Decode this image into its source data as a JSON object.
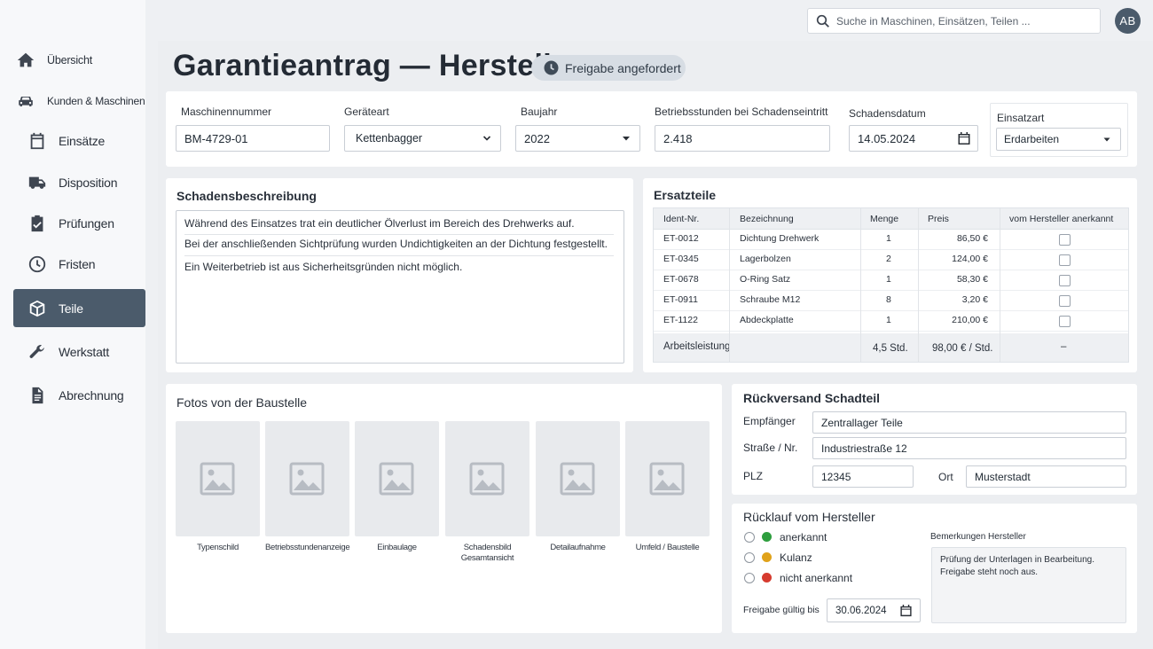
{
  "sidebar": {
    "items": [
      {
        "label": "Übersicht",
        "icon": "home-icon"
      },
      {
        "label": "Kunden & Maschinen",
        "icon": "car-icon"
      },
      {
        "label": "Einsätze",
        "icon": "calendar-icon"
      },
      {
        "label": "Disposition",
        "icon": "truck-icon"
      },
      {
        "label": "Prüfungen",
        "icon": "clipboard-check-icon"
      },
      {
        "label": "Fristen",
        "icon": "clock-icon"
      },
      {
        "label": "Teile",
        "icon": "box-icon",
        "active": true
      },
      {
        "label": "Werkstatt",
        "icon": "wrench-icon"
      },
      {
        "label": "Abrechnung",
        "icon": "document-icon"
      }
    ]
  },
  "topbar": {
    "search_placeholder": "Suche in Maschinen, Einsätzen, Teilen ...",
    "avatar_initials": "AB"
  },
  "header": {
    "title": "Garantieantrag — Hersteller",
    "status": "Freigabe angefordert"
  },
  "machine": {
    "number_label": "Maschinennummer",
    "number_value": "BM-4729-01",
    "type_label": "Geräteart",
    "type_value": "Kettenbagger",
    "year_label": "Baujahr",
    "year_value": "2022",
    "hours_label": "Betriebsstunden bei Schadenseintritt",
    "hours_value": "2.418",
    "date_label": "Schadensdatum",
    "date_value": "14.05.2024",
    "use_label": "Einsatzart",
    "use_value": "Erdarbeiten"
  },
  "description": {
    "title": "Schadensbeschreibung",
    "lines": [
      "Während des Einsatzes trat ein deutlicher Ölverlust im Bereich des Drehwerks auf.",
      "Bei der anschließenden Sichtprüfung wurden Undichtigkeiten an der Dichtung festgestellt.",
      "Ein Weiterbetrieb ist aus Sicherheitsgründen nicht möglich."
    ]
  },
  "parts": {
    "title": "Ersatzteile",
    "headers": [
      "Ident-Nr.",
      "Bezeichnung",
      "Menge",
      "Preis",
      "vom Hersteller anerkannt"
    ],
    "rows": [
      {
        "id": "ET-0012",
        "name": "Dichtung Drehwerk",
        "qty": "1",
        "price": "86,50 €"
      },
      {
        "id": "ET-0345",
        "name": "Lagerbolzen",
        "qty": "2",
        "price": "124,00 €"
      },
      {
        "id": "ET-0678",
        "name": "O-Ring Satz",
        "qty": "1",
        "price": "58,30 €"
      },
      {
        "id": "ET-0911",
        "name": "Schraube M12",
        "qty": "8",
        "price": "3,20 €"
      },
      {
        "id": "ET-1122",
        "name": "Abdeckplatte",
        "qty": "1",
        "price": "210,00 €"
      }
    ],
    "labor": {
      "label": "Arbeitsleistung",
      "qty": "4,5 Std.",
      "price": "98,00 € / Std.",
      "approved": "–"
    }
  },
  "photos": {
    "title": "Fotos von der Baustelle",
    "items": [
      {
        "caption": "Typenschild"
      },
      {
        "caption": "Betriebsstundenanzeige"
      },
      {
        "caption": "Einbaulage"
      },
      {
        "caption": "Schadensbild Gesamtansicht"
      },
      {
        "caption": "Detailaufnahme"
      },
      {
        "caption": "Umfeld / Baustelle"
      }
    ]
  },
  "shipping": {
    "title": "Rückversand Schadteil",
    "recipient_label": "Empfänger",
    "recipient_value": "Zentrallager Teile",
    "street_label": "Straße / Nr.",
    "street_value": "Industriestraße 12",
    "zip_label": "PLZ",
    "zip_value": "12345",
    "city_label": "Ort",
    "city_value": "Musterstadt"
  },
  "response": {
    "title": "Rücklauf vom Hersteller",
    "options": [
      {
        "label": "anerkannt",
        "color": "#2e9e3e"
      },
      {
        "label": "Kulanz",
        "color": "#e0a21a"
      },
      {
        "label": "nicht anerkannt",
        "color": "#d63b2f"
      }
    ],
    "remarks_label": "Bemerkungen Hersteller",
    "remarks_value": "Prüfung der Unterlagen in Bearbeitung. Freigabe steht noch aus.",
    "valid_label": "Freigabe gültig bis",
    "valid_value": "30.06.2024"
  }
}
